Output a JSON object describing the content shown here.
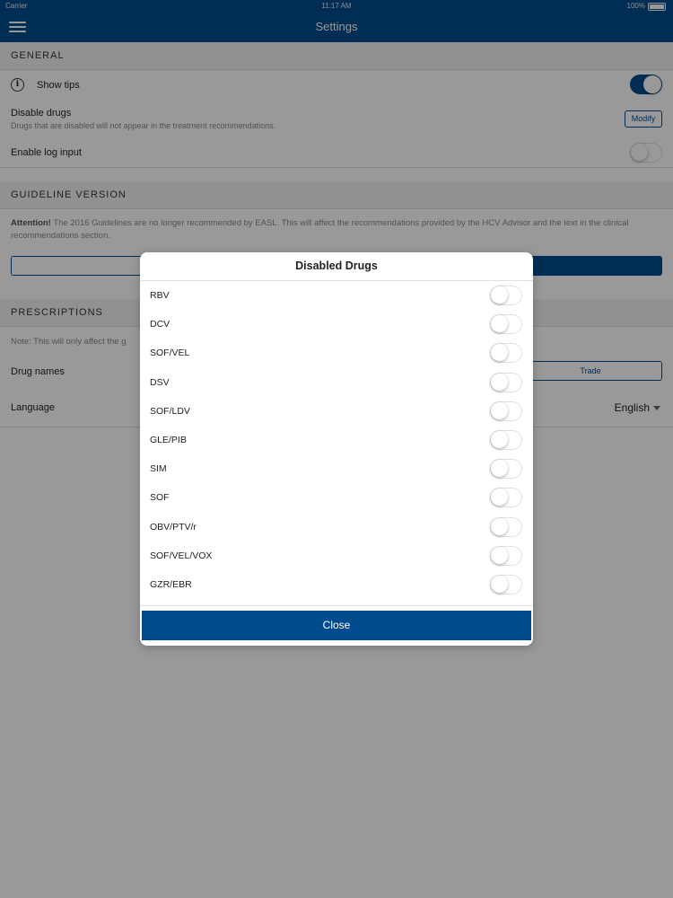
{
  "status_bar": {
    "carrier": "Carrier",
    "time": "11:17 AM",
    "battery": "100%"
  },
  "nav": {
    "title": "Settings"
  },
  "general": {
    "header": "GENERAL",
    "show_tips_label": "Show tips",
    "disable_drugs_label": "Disable drugs",
    "disable_drugs_sub": "Drugs that are disabled will not appear in the treatment recommendations.",
    "modify_label": "Modify",
    "enable_log_label": "Enable log input",
    "show_tips_on": true,
    "enable_log_on": false
  },
  "guideline": {
    "header": "GUIDELINE VERSION",
    "attention_bold": "Attention!",
    "attention_text": " The 2016 Guidelines are no longer recommended by EASL. This will affect the recommendations provided by the HCV Advisor and the text in the clinical recommendations section."
  },
  "prescriptions": {
    "header": "PRESCRIPTIONS",
    "note": "Note: This will only affect the g",
    "drug_names_label": "Drug names",
    "trade_label": "Trade",
    "language_label": "Language",
    "language_value": "English"
  },
  "modal": {
    "title": "Disabled Drugs",
    "close_label": "Close",
    "drugs": [
      {
        "label": "RBV",
        "enabled": false
      },
      {
        "label": "DCV",
        "enabled": false
      },
      {
        "label": "SOF/VEL",
        "enabled": false
      },
      {
        "label": "DSV",
        "enabled": false
      },
      {
        "label": "SOF/LDV",
        "enabled": false
      },
      {
        "label": "GLE/PIB",
        "enabled": false
      },
      {
        "label": "SIM",
        "enabled": false
      },
      {
        "label": "SOF",
        "enabled": false
      },
      {
        "label": "OBV/PTV/r",
        "enabled": false
      },
      {
        "label": "SOF/VEL/VOX",
        "enabled": false
      },
      {
        "label": "GZR/EBR",
        "enabled": false
      }
    ]
  },
  "colors": {
    "brand": "#004b8d"
  }
}
